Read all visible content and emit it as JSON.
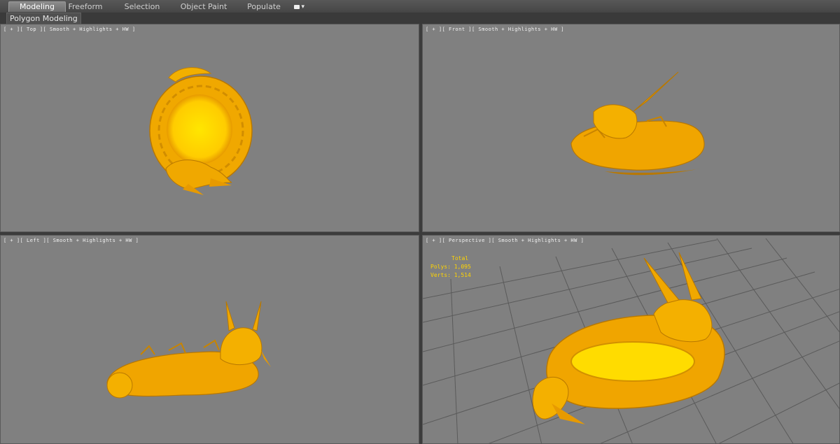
{
  "tabs": [
    {
      "label": "Modeling",
      "active": true
    },
    {
      "label": "Freeform",
      "active": false
    },
    {
      "label": "Selection",
      "active": false
    },
    {
      "label": "Object Paint",
      "active": false
    },
    {
      "label": "Populate",
      "active": false
    }
  ],
  "subbar": {
    "label": "Polygon Modeling"
  },
  "viewports": {
    "top": {
      "label": "[ + ][ Top ][ Smooth + Highlights + HW ]"
    },
    "front": {
      "label": "[ + ][ Front ][ Smooth + Highlights + HW ]"
    },
    "left": {
      "label": "[ + ][ Left ][ Smooth + Highlights + HW ]"
    },
    "perspective": {
      "label": "[ + ][ Perspective ][ Smooth + Highlights + HW ]"
    }
  },
  "stats": {
    "header": "Total",
    "polys_label": "Polys:",
    "polys_value": "1,095",
    "verts_label": "Verts:",
    "verts_value": "1,514"
  },
  "colors": {
    "viewport_bg": "#808080",
    "model_gold": "#f0a500",
    "model_highlight": "#ffd21a",
    "stats_text": "#ffd400"
  },
  "icons": {
    "extra_tab": "camera-dropdown-icon"
  }
}
